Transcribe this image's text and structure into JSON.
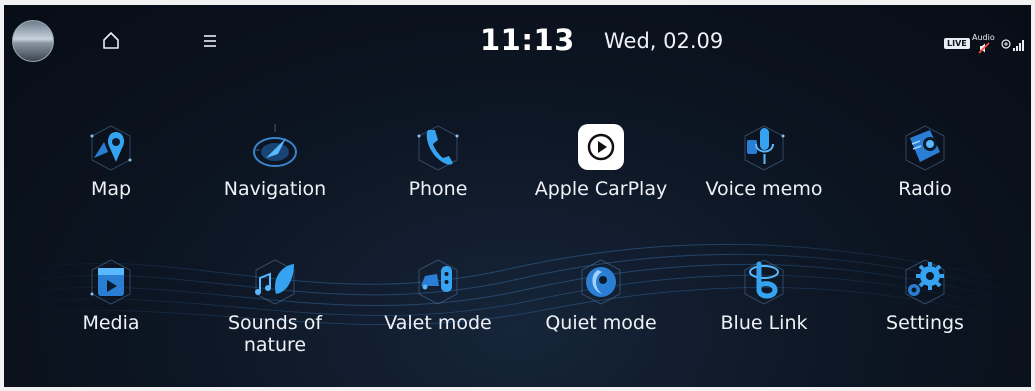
{
  "status_bar": {
    "time": "11:13",
    "date": "Wed, 02.09",
    "live_badge": "LIVE",
    "audio_label": "Audio"
  },
  "colors": {
    "background": "#0b1220",
    "accent": "#2f8bd8",
    "text": "#eef2f6"
  },
  "apps": [
    {
      "label": "Map",
      "icon": "map-pin-icon"
    },
    {
      "label": "Navigation",
      "icon": "compass-icon"
    },
    {
      "label": "Phone",
      "icon": "phone-handset-icon"
    },
    {
      "label": "Apple CarPlay",
      "icon": "carplay-play-icon"
    },
    {
      "label": "Voice memo",
      "icon": "microphone-icon"
    },
    {
      "label": "Radio",
      "icon": "radio-waves-icon"
    },
    {
      "label": "Media",
      "icon": "film-clip-icon"
    },
    {
      "label": "Sounds of\nnature",
      "icon": "leaf-note-icon"
    },
    {
      "label": "Valet mode",
      "icon": "car-key-icon"
    },
    {
      "label": "Quiet mode",
      "icon": "moon-icon"
    },
    {
      "label": "Blue Link",
      "icon": "bluelink-logo-icon"
    },
    {
      "label": "Settings",
      "icon": "gears-icon"
    }
  ]
}
